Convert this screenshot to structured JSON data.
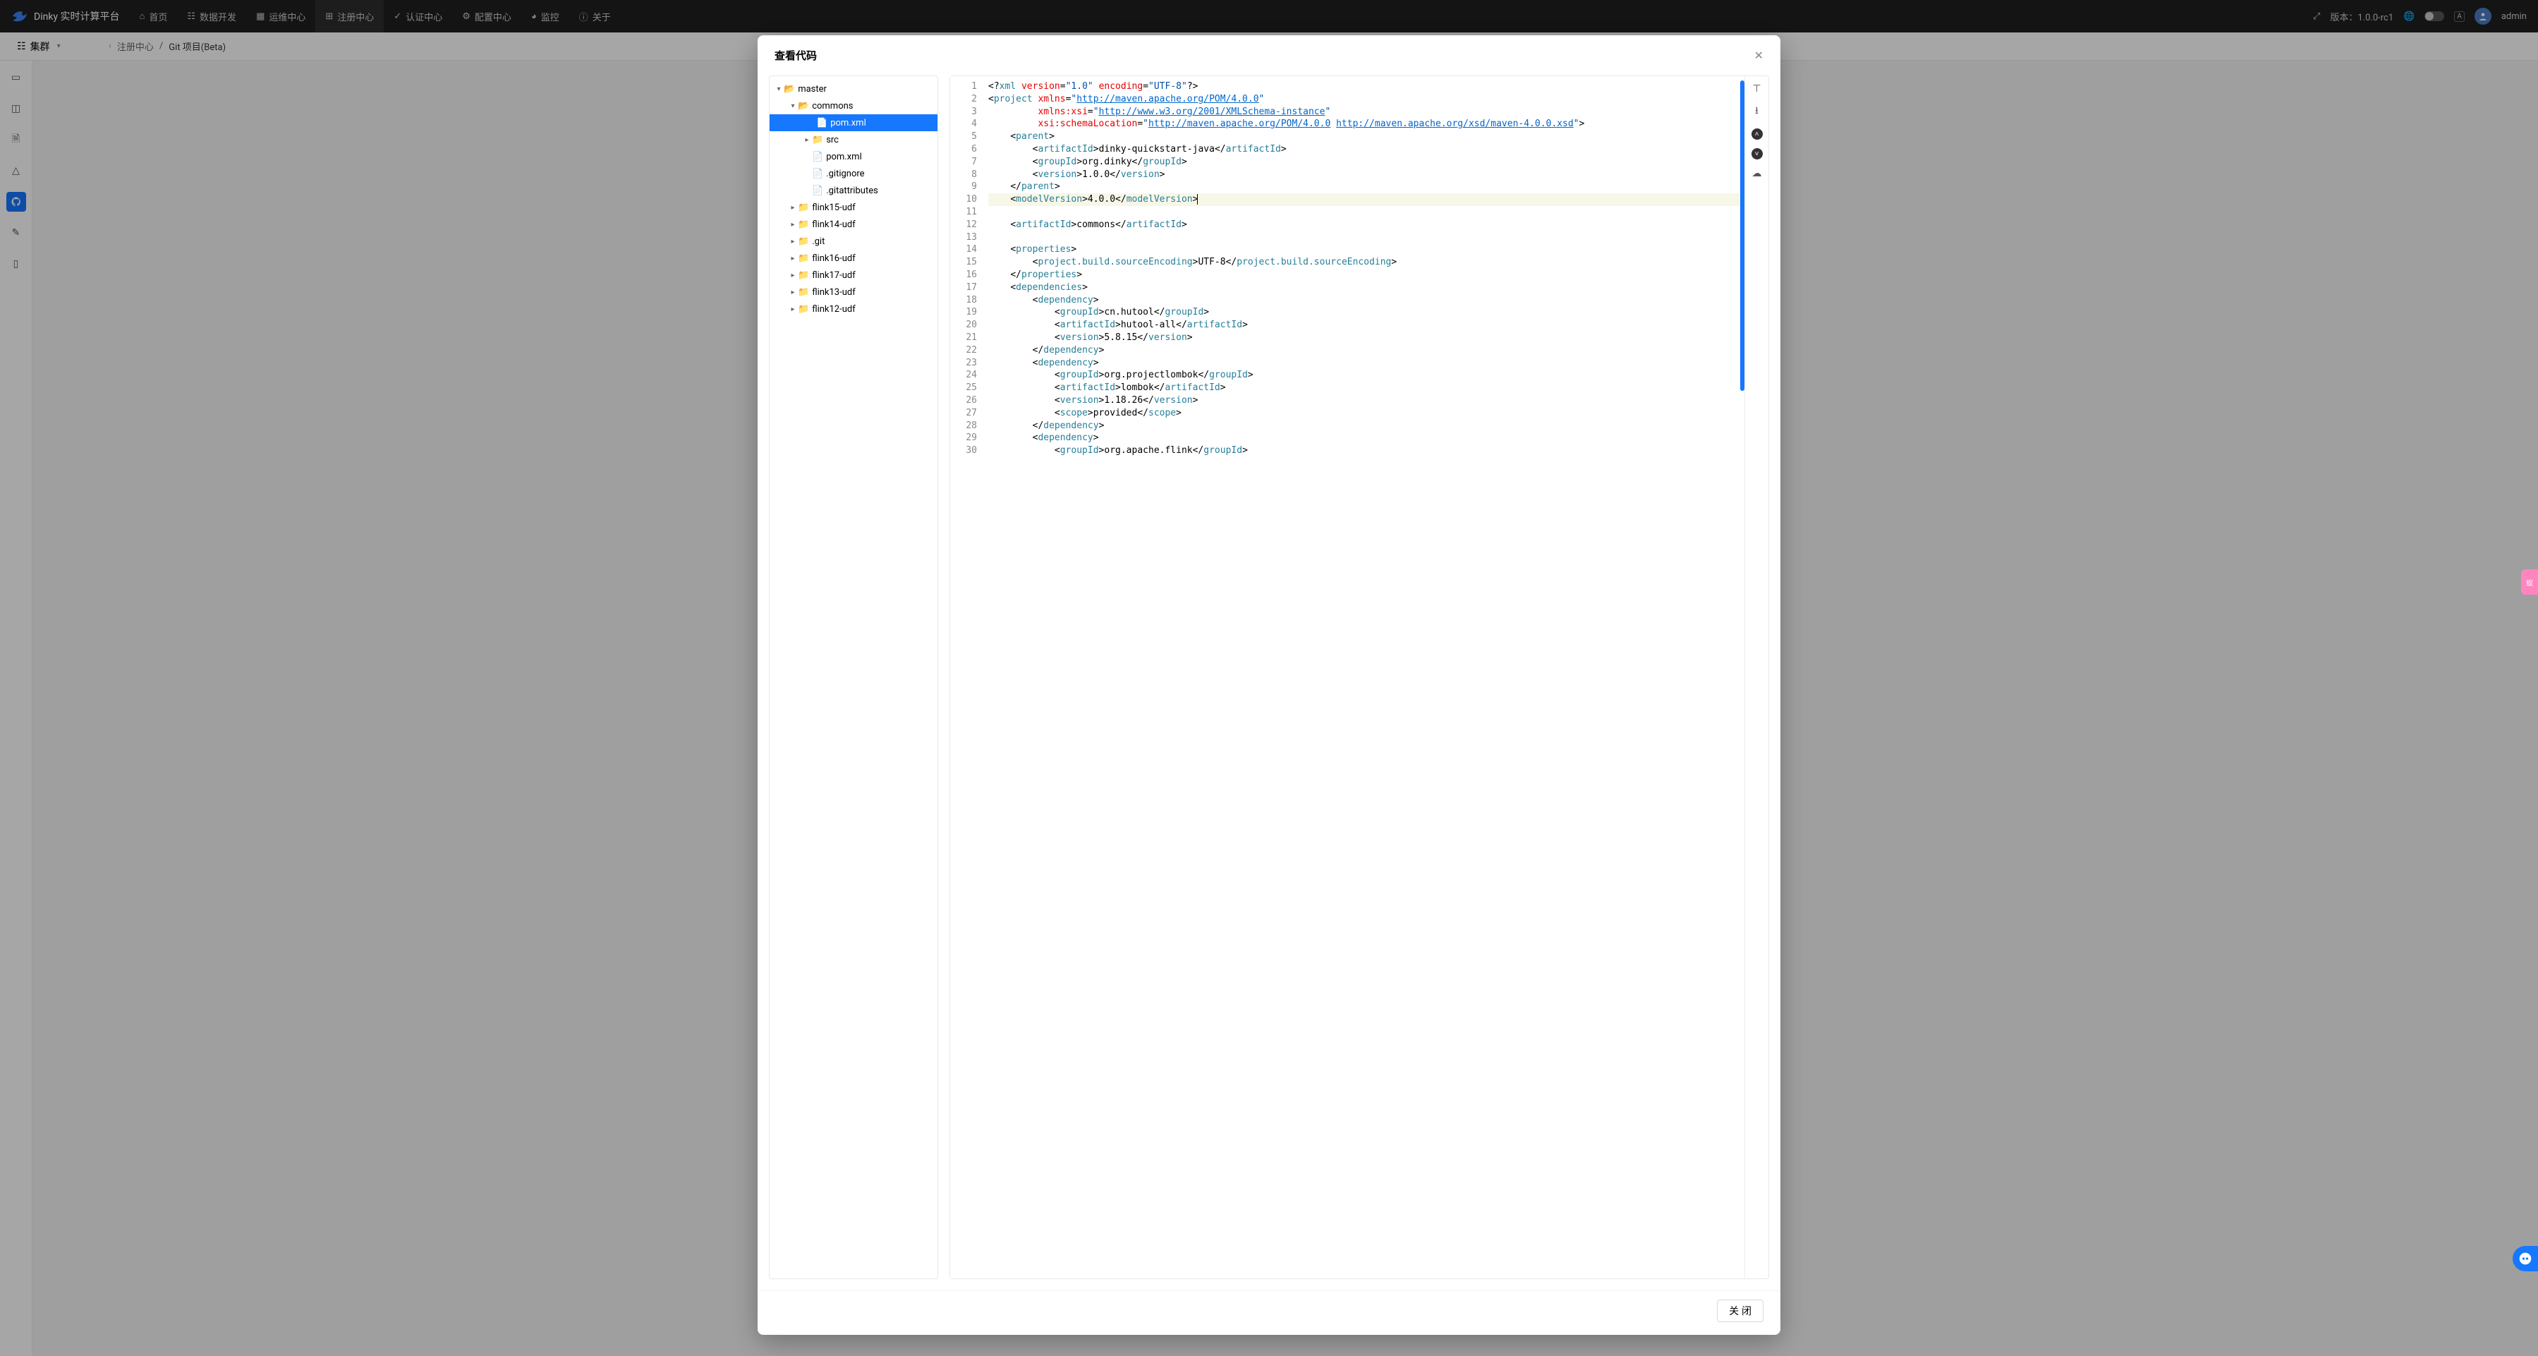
{
  "app": {
    "title": "Dinky 实时计算平台"
  },
  "nav": {
    "items": [
      {
        "icon": "home",
        "label": "首页"
      },
      {
        "icon": "code",
        "label": "数据开发"
      },
      {
        "icon": "ops",
        "label": "运维中心"
      },
      {
        "icon": "reg",
        "label": "注册中心",
        "active": true
      },
      {
        "icon": "auth",
        "label": "认证中心"
      },
      {
        "icon": "cfg",
        "label": "配置中心"
      },
      {
        "icon": "mon",
        "label": "监控"
      },
      {
        "icon": "about",
        "label": "关于"
      }
    ]
  },
  "header_right": {
    "version_label": "版本：",
    "version": "1.0.0-rc1",
    "user": "admin"
  },
  "subnav": {
    "cluster": "集群"
  },
  "breadcrumb": {
    "a": "注册中心",
    "b": "Git 项目(Beta)"
  },
  "modal": {
    "title": "查看代码",
    "close_label": "关 闭"
  },
  "tree": {
    "level0": {
      "name": "master"
    },
    "level1": {
      "name": "commons"
    },
    "level2_sel": {
      "name": "pom.xml"
    },
    "src": {
      "name": "src"
    },
    "pom": {
      "name": "pom.xml"
    },
    "gitignore": {
      "name": ".gitignore"
    },
    "gitattr": {
      "name": ".gitattributes"
    },
    "f15": {
      "name": "flink15-udf"
    },
    "f14": {
      "name": "flink14-udf"
    },
    "git": {
      "name": ".git"
    },
    "f16": {
      "name": "flink16-udf"
    },
    "f17": {
      "name": "flink17-udf"
    },
    "f13": {
      "name": "flink13-udf"
    },
    "f12": {
      "name": "flink12-udf"
    }
  },
  "code": {
    "urls": {
      "pom": "http://maven.apache.org/POM/4.0.0",
      "xsi": "http://www.w3.org/2001/XMLSchema-instance",
      "xsd": "http://maven.apache.org/xsd/maven-4.0.0.xsd"
    },
    "vals": {
      "xmlver": "1.0",
      "enc": "UTF-8",
      "parent_artifact": "dinky-quickstart-java",
      "parent_group": "org.dinky",
      "parent_version": "1.0.0",
      "model_version": "4.0.0",
      "artifact": "commons",
      "src_enc": "UTF-8",
      "hutool_group": "cn.hutool",
      "hutool_artifact": "hutool-all",
      "hutool_version": "5.8.15",
      "lombok_group": "org.projectlombok",
      "lombok_artifact": "lombok",
      "lombok_version": "1.18.26",
      "lombok_scope": "provided",
      "flink_group": "org.apache.flink"
    }
  }
}
